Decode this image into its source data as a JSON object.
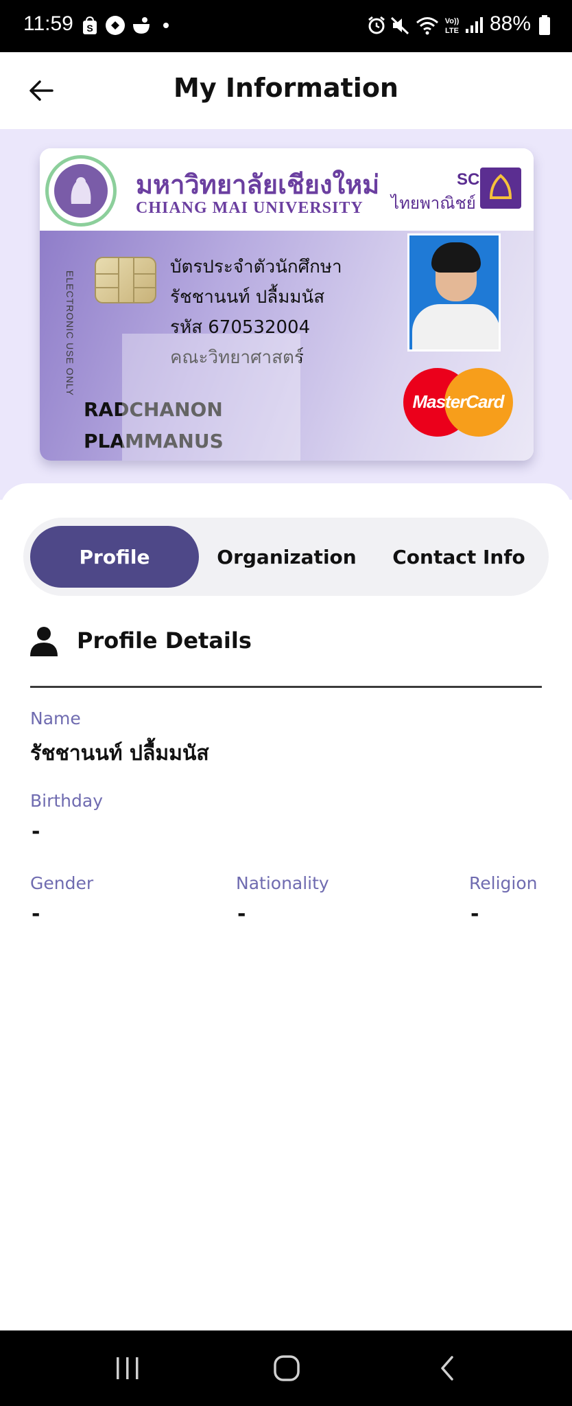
{
  "status_bar": {
    "time": "11:59",
    "battery": "88%",
    "icons": [
      "shopee-icon",
      "app-icon",
      "bowl-icon",
      "dot-icon",
      "alarm-icon",
      "mute-icon",
      "wifi-icon",
      "volte-icon",
      "signal-icon",
      "battery-icon"
    ]
  },
  "app_bar": {
    "title": "My Information",
    "back_icon": "arrow-left-icon"
  },
  "card": {
    "university_th": "มหาวิทยาลัยเชียงใหม่",
    "university_en": "CHIANG MAI UNIVERSITY",
    "bank_en": "SCB",
    "bank_th": "ไทยพาณิชย์",
    "vertical_text": "ELECTRONIC USE ONLY",
    "lines": [
      "บัตรประจำตัวนักศึกษา",
      "รัชชานนท์ ปลื้มมนัส",
      "รหัส 670532004",
      "คณะวิทยาศาสตร์"
    ],
    "name_en_1": "RADCHANON",
    "name_en_2": "PLAMMANUS",
    "network": "MasterCard"
  },
  "tabs": [
    {
      "label": "Profile",
      "active": true
    },
    {
      "label": "Organization",
      "active": false
    },
    {
      "label": "Contact Info",
      "active": false
    }
  ],
  "section": {
    "title": "Profile Details",
    "icon": "person-icon"
  },
  "fields": {
    "name_label": "Name",
    "name_value": "รัชชานนท์ ปลื้มมนัส",
    "birthday_label": "Birthday",
    "birthday_value": "-",
    "gender_label": "Gender",
    "gender_value": "-",
    "nationality_label": "Nationality",
    "nationality_value": "-",
    "religion_label": "Religion",
    "religion_value": "-"
  },
  "nav": {
    "recents_icon": "recents-icon",
    "home_icon": "home-icon",
    "back_icon": "back-chevron-icon"
  },
  "colors": {
    "accent": "#4e4888",
    "label": "#6f6bb0",
    "card_bg": "#ebe7fb"
  }
}
